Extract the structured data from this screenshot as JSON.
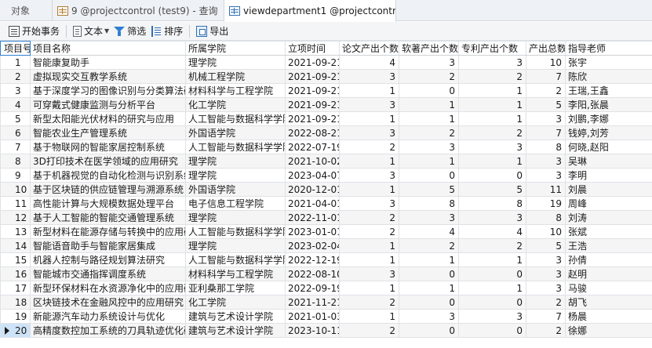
{
  "tabs": [
    {
      "label": "对象"
    },
    {
      "label": "9 @projectcontrol (test9) - 查询"
    },
    {
      "label": "viewdepartment1 @projectcontrol (..."
    }
  ],
  "toolbar": {
    "begin_txn": "开始事务",
    "text": "文本",
    "filter": "筛选",
    "sort": "排序",
    "export": "导出"
  },
  "columns": [
    "项目号",
    "项目名称",
    "所属学院",
    "立项时间",
    "论文产出个数",
    "软著产出个数",
    "专利产出个数",
    "产出总数",
    "指导老师"
  ],
  "rows": [
    [
      "1",
      "智能康复助手",
      "理学院",
      "2021-09-21",
      "4",
      "3",
      "3",
      "10",
      "张宇"
    ],
    [
      "2",
      "虚拟现实交互教学系统",
      "机械工程学院",
      "2021-09-21",
      "3",
      "2",
      "2",
      "7",
      "陈欣"
    ],
    [
      "3",
      "基于深度学习的图像识别与分类算法研究",
      "材料科学与工程学院",
      "2021-09-21",
      "1",
      "0",
      "1",
      "2",
      "王瑞,王鑫"
    ],
    [
      "4",
      "可穿戴式健康监测与分析平台",
      "化工学院",
      "2021-09-21",
      "3",
      "1",
      "1",
      "5",
      "李阳,张晨"
    ],
    [
      "5",
      "新型太阳能光伏材料的研究与应用",
      "人工智能与数据科学学院",
      "2021-09-21",
      "1",
      "1",
      "1",
      "3",
      "刘鹏,李娜"
    ],
    [
      "6",
      "智能农业生产管理系统",
      "外国语学院",
      "2022-08-21",
      "3",
      "2",
      "2",
      "7",
      "钱婷,刘芳"
    ],
    [
      "7",
      "基于物联网的智能家居控制系统",
      "人工智能与数据科学学院",
      "2022-07-19",
      "2",
      "3",
      "3",
      "8",
      "何晓,赵阳"
    ],
    [
      "8",
      "3D打印技术在医学领域的应用研究",
      "理学院",
      "2021-10-02",
      "1",
      "1",
      "1",
      "3",
      "吴琳"
    ],
    [
      "9",
      "基于机器视觉的自动化检测与识别系统",
      "理学院",
      "2023-04-07",
      "3",
      "0",
      "0",
      "3",
      "李明"
    ],
    [
      "10",
      "基于区块链的供应链管理与溯源系统",
      "外国语学院",
      "2020-12-01",
      "1",
      "5",
      "5",
      "11",
      "刘晨"
    ],
    [
      "11",
      "高性能计算与大规模数据处理平台",
      "电子信息工程学院",
      "2021-04-01",
      "3",
      "8",
      "8",
      "19",
      "周峰"
    ],
    [
      "12",
      "基于人工智能的智能交通管理系统",
      "理学院",
      "2022-11-01",
      "2",
      "3",
      "3",
      "8",
      "刘涛"
    ],
    [
      "13",
      "新型材料在能源存储与转换中的应用研究",
      "人工智能与数据科学学院",
      "2023-01-01",
      "2",
      "4",
      "4",
      "10",
      "张斌"
    ],
    [
      "14",
      "智能语音助手与智能家居集成",
      "理学院",
      "2023-02-04",
      "1",
      "2",
      "2",
      "5",
      "王浩"
    ],
    [
      "15",
      "机器人控制与路径规划算法研究",
      "人工智能与数据科学学院",
      "2022-12-19",
      "1",
      "1",
      "1",
      "3",
      "孙倩"
    ],
    [
      "16",
      "智能城市交通指挥调度系统",
      "材料科学与工程学院",
      "2022-08-10",
      "3",
      "0",
      "0",
      "3",
      "赵明"
    ],
    [
      "17",
      "新型环保材料在水资源净化中的应用研究",
      "亚利桑那工学院",
      "2022-09-19",
      "1",
      "1",
      "1",
      "3",
      "马骏"
    ],
    [
      "18",
      "区块链技术在金融风控中的应用研究",
      "化工学院",
      "2021-11-21",
      "2",
      "0",
      "0",
      "2",
      "胡飞"
    ],
    [
      "19",
      "新能源汽车动力系统设计与优化",
      "建筑与艺术设计学院",
      "2021-01-03",
      "1",
      "3",
      "3",
      "7",
      "杨晨"
    ],
    [
      "20",
      "高精度数控加工系统的刀具轨迹优化研究",
      "建筑与艺术设计学院",
      "2023-10-11",
      "2",
      "0",
      "0",
      "2",
      "徐娜"
    ]
  ],
  "current_row": "20"
}
